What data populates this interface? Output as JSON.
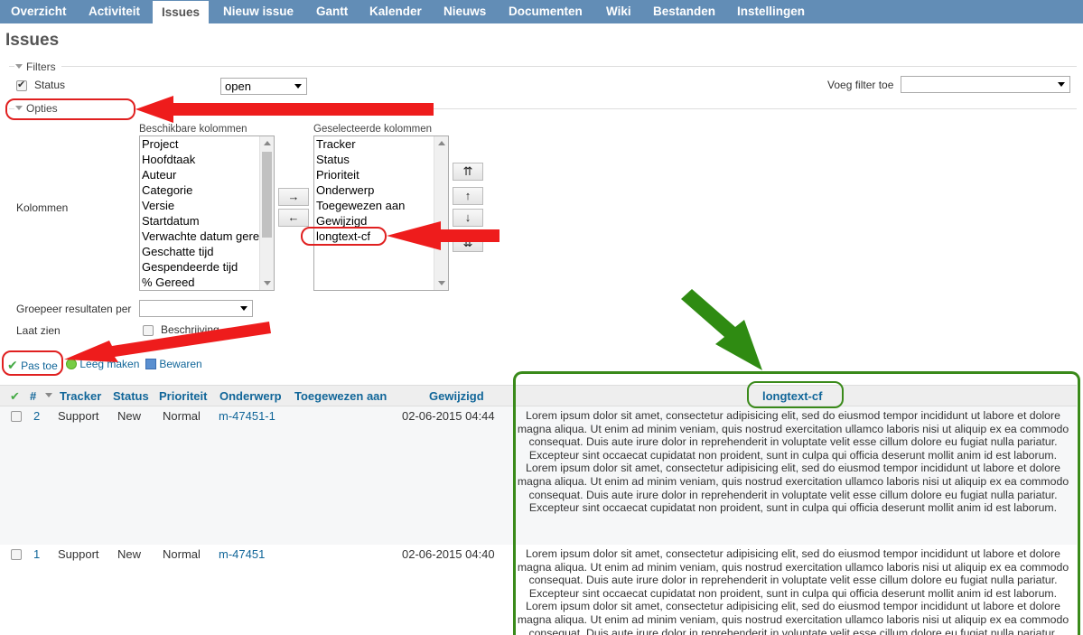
{
  "nav": {
    "tabs": [
      "Overzicht",
      "Activiteit",
      "Issues",
      "Nieuw issue",
      "Gantt",
      "Kalender",
      "Nieuws",
      "Documenten",
      "Wiki",
      "Bestanden",
      "Instellingen"
    ],
    "selected": "Issues"
  },
  "page_title": "Issues",
  "filters": {
    "legend": "Filters",
    "status_label": "Status",
    "status_value": "open",
    "add_filter_label": "Voeg filter toe",
    "add_filter_value": ""
  },
  "options": {
    "legend": "Opties",
    "columns_label": "Kolommen",
    "available_title": "Beschikbare kolommen",
    "available": [
      "Project",
      "Hoofdtaak",
      "Auteur",
      "Categorie",
      "Versie",
      "Startdatum",
      "Verwachte datum gereed",
      "Geschatte tijd",
      "Gespendeerde tijd",
      "% Gereed"
    ],
    "selected_title": "Geselecteerde kolommen",
    "selected": [
      "Tracker",
      "Status",
      "Prioriteit",
      "Onderwerp",
      "Toegewezen aan",
      "Gewijzigd",
      "longtext-cf"
    ],
    "move_buttons": [
      "→",
      "←"
    ],
    "order_buttons": [
      "⇈",
      "↑",
      "↓",
      "⇊"
    ],
    "group_label": "Groepeer resultaten per",
    "group_value": "",
    "show_label": "Laat zien",
    "description_label": "Beschrijving"
  },
  "actions": {
    "apply": "Pas toe",
    "clear": "Leeg maken",
    "save": "Bewaren"
  },
  "table": {
    "headers": [
      "#",
      "Tracker",
      "Status",
      "Prioriteit",
      "Onderwerp",
      "Toegewezen aan",
      "Gewijzigd",
      "longtext-cf"
    ],
    "rows": [
      {
        "id": "2",
        "tracker": "Support",
        "status": "New",
        "priority": "Normal",
        "subject": "m-47451-1",
        "assignee": "",
        "updated": "02-06-2015 04:44",
        "longtext": "Lorem ipsum dolor sit amet, consectetur adipisicing elit, sed do eiusmod tempor incididunt ut labore et dolore magna aliqua. Ut enim ad minim veniam, quis nostrud exercitation ullamco laboris nisi ut aliquip ex ea commodo consequat. Duis aute irure dolor in reprehenderit in voluptate velit esse cillum dolore eu fugiat nulla pariatur. Excepteur sint occaecat cupidatat non proident, sunt in culpa qui officia deserunt mollit anim id est laborum.\nLorem ipsum dolor sit amet, consectetur adipisicing elit, sed do eiusmod tempor incididunt ut labore et dolore magna aliqua. Ut enim ad minim veniam, quis nostrud exercitation ullamco laboris nisi ut aliquip ex ea commodo consequat. Duis aute irure dolor in reprehenderit in voluptate velit esse cillum dolore eu fugiat nulla pariatur. Excepteur sint occaecat cupidatat non proident, sunt in culpa qui officia deserunt mollit anim id est laborum."
      },
      {
        "id": "1",
        "tracker": "Support",
        "status": "New",
        "priority": "Normal",
        "subject": "m-47451",
        "assignee": "",
        "updated": "02-06-2015 04:40",
        "longtext": "Lorem ipsum dolor sit amet, consectetur adipisicing elit, sed do eiusmod tempor incididunt ut labore et dolore magna aliqua. Ut enim ad minim veniam, quis nostrud exercitation ullamco laboris nisi ut aliquip ex ea commodo consequat. Duis aute irure dolor in reprehenderit in voluptate velit esse cillum dolore eu fugiat nulla pariatur. Excepteur sint occaecat cupidatat non proident, sunt in culpa qui officia deserunt mollit anim id est laborum.\nLorem ipsum dolor sit amet, consectetur adipisicing elit, sed do eiusmod tempor incididunt ut labore et dolore magna aliqua. Ut enim ad minim veniam, quis nostrud exercitation ullamco laboris nisi ut aliquip ex ea commodo consequat. Duis aute irure dolor in reprehenderit in voluptate velit esse cillum dolore eu fugiat nulla pariatur."
      }
    ]
  },
  "colors": {
    "nav_bg": "#628db6",
    "link": "#116699",
    "annotation_red": "#e02020",
    "annotation_green": "#3a8a1a"
  }
}
